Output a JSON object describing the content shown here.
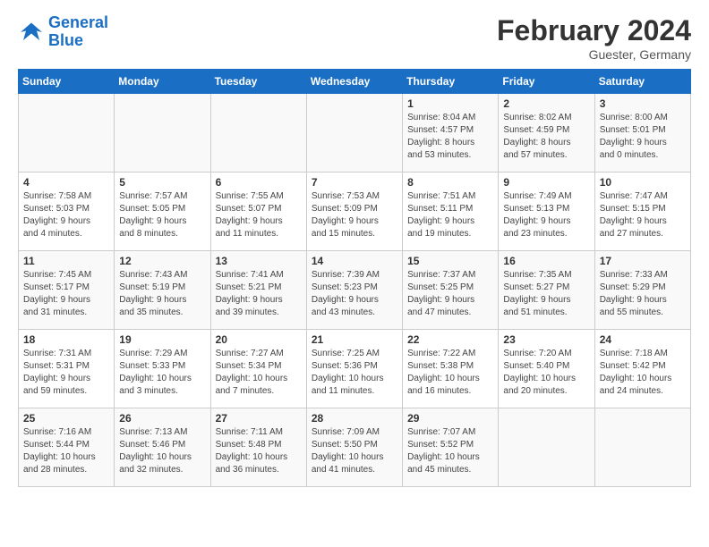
{
  "logo": {
    "line1": "General",
    "line2": "Blue"
  },
  "title": "February 2024",
  "location": "Guester, Germany",
  "days_of_week": [
    "Sunday",
    "Monday",
    "Tuesday",
    "Wednesday",
    "Thursday",
    "Friday",
    "Saturday"
  ],
  "weeks": [
    [
      {
        "day": "",
        "info": ""
      },
      {
        "day": "",
        "info": ""
      },
      {
        "day": "",
        "info": ""
      },
      {
        "day": "",
        "info": ""
      },
      {
        "day": "1",
        "info": "Sunrise: 8:04 AM\nSunset: 4:57 PM\nDaylight: 8 hours\nand 53 minutes."
      },
      {
        "day": "2",
        "info": "Sunrise: 8:02 AM\nSunset: 4:59 PM\nDaylight: 8 hours\nand 57 minutes."
      },
      {
        "day": "3",
        "info": "Sunrise: 8:00 AM\nSunset: 5:01 PM\nDaylight: 9 hours\nand 0 minutes."
      }
    ],
    [
      {
        "day": "4",
        "info": "Sunrise: 7:58 AM\nSunset: 5:03 PM\nDaylight: 9 hours\nand 4 minutes."
      },
      {
        "day": "5",
        "info": "Sunrise: 7:57 AM\nSunset: 5:05 PM\nDaylight: 9 hours\nand 8 minutes."
      },
      {
        "day": "6",
        "info": "Sunrise: 7:55 AM\nSunset: 5:07 PM\nDaylight: 9 hours\nand 11 minutes."
      },
      {
        "day": "7",
        "info": "Sunrise: 7:53 AM\nSunset: 5:09 PM\nDaylight: 9 hours\nand 15 minutes."
      },
      {
        "day": "8",
        "info": "Sunrise: 7:51 AM\nSunset: 5:11 PM\nDaylight: 9 hours\nand 19 minutes."
      },
      {
        "day": "9",
        "info": "Sunrise: 7:49 AM\nSunset: 5:13 PM\nDaylight: 9 hours\nand 23 minutes."
      },
      {
        "day": "10",
        "info": "Sunrise: 7:47 AM\nSunset: 5:15 PM\nDaylight: 9 hours\nand 27 minutes."
      }
    ],
    [
      {
        "day": "11",
        "info": "Sunrise: 7:45 AM\nSunset: 5:17 PM\nDaylight: 9 hours\nand 31 minutes."
      },
      {
        "day": "12",
        "info": "Sunrise: 7:43 AM\nSunset: 5:19 PM\nDaylight: 9 hours\nand 35 minutes."
      },
      {
        "day": "13",
        "info": "Sunrise: 7:41 AM\nSunset: 5:21 PM\nDaylight: 9 hours\nand 39 minutes."
      },
      {
        "day": "14",
        "info": "Sunrise: 7:39 AM\nSunset: 5:23 PM\nDaylight: 9 hours\nand 43 minutes."
      },
      {
        "day": "15",
        "info": "Sunrise: 7:37 AM\nSunset: 5:25 PM\nDaylight: 9 hours\nand 47 minutes."
      },
      {
        "day": "16",
        "info": "Sunrise: 7:35 AM\nSunset: 5:27 PM\nDaylight: 9 hours\nand 51 minutes."
      },
      {
        "day": "17",
        "info": "Sunrise: 7:33 AM\nSunset: 5:29 PM\nDaylight: 9 hours\nand 55 minutes."
      }
    ],
    [
      {
        "day": "18",
        "info": "Sunrise: 7:31 AM\nSunset: 5:31 PM\nDaylight: 9 hours\nand 59 minutes."
      },
      {
        "day": "19",
        "info": "Sunrise: 7:29 AM\nSunset: 5:33 PM\nDaylight: 10 hours\nand 3 minutes."
      },
      {
        "day": "20",
        "info": "Sunrise: 7:27 AM\nSunset: 5:34 PM\nDaylight: 10 hours\nand 7 minutes."
      },
      {
        "day": "21",
        "info": "Sunrise: 7:25 AM\nSunset: 5:36 PM\nDaylight: 10 hours\nand 11 minutes."
      },
      {
        "day": "22",
        "info": "Sunrise: 7:22 AM\nSunset: 5:38 PM\nDaylight: 10 hours\nand 16 minutes."
      },
      {
        "day": "23",
        "info": "Sunrise: 7:20 AM\nSunset: 5:40 PM\nDaylight: 10 hours\nand 20 minutes."
      },
      {
        "day": "24",
        "info": "Sunrise: 7:18 AM\nSunset: 5:42 PM\nDaylight: 10 hours\nand 24 minutes."
      }
    ],
    [
      {
        "day": "25",
        "info": "Sunrise: 7:16 AM\nSunset: 5:44 PM\nDaylight: 10 hours\nand 28 minutes."
      },
      {
        "day": "26",
        "info": "Sunrise: 7:13 AM\nSunset: 5:46 PM\nDaylight: 10 hours\nand 32 minutes."
      },
      {
        "day": "27",
        "info": "Sunrise: 7:11 AM\nSunset: 5:48 PM\nDaylight: 10 hours\nand 36 minutes."
      },
      {
        "day": "28",
        "info": "Sunrise: 7:09 AM\nSunset: 5:50 PM\nDaylight: 10 hours\nand 41 minutes."
      },
      {
        "day": "29",
        "info": "Sunrise: 7:07 AM\nSunset: 5:52 PM\nDaylight: 10 hours\nand 45 minutes."
      },
      {
        "day": "",
        "info": ""
      },
      {
        "day": "",
        "info": ""
      }
    ]
  ]
}
